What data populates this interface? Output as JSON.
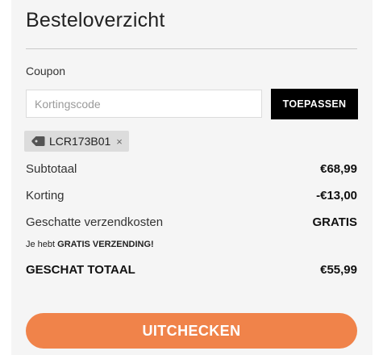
{
  "summary": {
    "title": "Besteloverzicht"
  },
  "coupon": {
    "label": "Coupon",
    "input_placeholder": "Kortingscode",
    "input_value": "",
    "apply_label": "TOEPASSEN",
    "applied_code": "LCR173B01",
    "remove_symbol": "×"
  },
  "lines": {
    "subtotal_label": "Subtotaal",
    "subtotal_value": "€68,99",
    "discount_label": "Korting",
    "discount_value": "-€13,00",
    "shipping_label": "Geschatte verzendkosten",
    "shipping_value": "GRATIS"
  },
  "note": {
    "prefix": "Je hebt ",
    "emphasis": "GRATIS VERZENDING!"
  },
  "total": {
    "label": "GESCHAT TOTAAL",
    "value": "€55,99"
  },
  "checkout": {
    "label": "UITCHECKEN"
  },
  "colors": {
    "panel_bg": "#f5f5f5",
    "apply_bg": "#000000",
    "chip_bg": "#dcdcdc",
    "checkout_bg": "#f0834a"
  },
  "icons": {
    "coupon_tag": "tag-icon",
    "remove": "close-icon"
  }
}
